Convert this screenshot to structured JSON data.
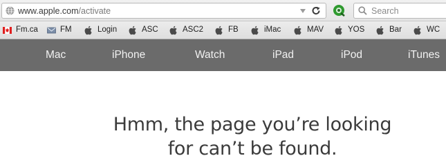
{
  "browser": {
    "url_host": "www.apple.com",
    "url_path": "/activate",
    "search_placeholder": "Search"
  },
  "bookmarks": [
    {
      "label": "Fm.ca",
      "icon": "canada-flag-icon"
    },
    {
      "label": "FM",
      "icon": "mail-icon"
    },
    {
      "label": "Login",
      "icon": "apple-logo-icon"
    },
    {
      "label": "ASC",
      "icon": "apple-logo-icon"
    },
    {
      "label": "ASC2",
      "icon": "apple-logo-icon"
    },
    {
      "label": "FB",
      "icon": "apple-logo-icon"
    },
    {
      "label": "iMac",
      "icon": "apple-logo-icon"
    },
    {
      "label": "MAV",
      "icon": "apple-logo-icon"
    },
    {
      "label": "YOS",
      "icon": "apple-logo-icon"
    },
    {
      "label": "Bar",
      "icon": "apple-logo-icon"
    },
    {
      "label": "WC",
      "icon": "apple-logo-icon"
    }
  ],
  "nav": {
    "items": [
      "Mac",
      "iPhone",
      "Watch",
      "iPad",
      "iPod",
      "iTunes"
    ]
  },
  "main": {
    "headline_line1": "Hmm, the page you’re looking",
    "headline_line2": "for can’t be found."
  },
  "colors": {
    "nav_background": "#6b6b6b",
    "nav_text": "#f2f2f2",
    "headline_text": "#3b3b3b"
  }
}
